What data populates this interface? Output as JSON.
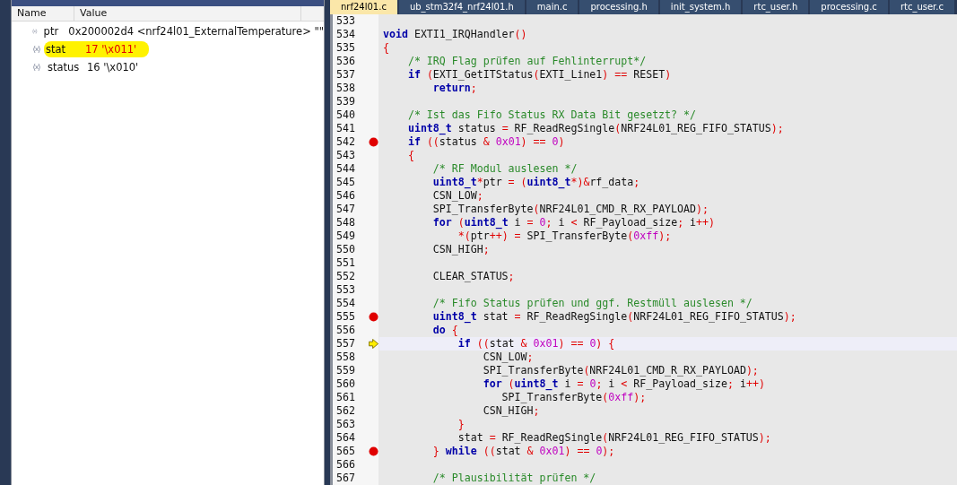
{
  "watches": {
    "columns": [
      "Name",
      "Value"
    ],
    "rows": [
      {
        "name": "ptr",
        "value": "0x200002d4 <nrf24l01_ExternalTemperature> \"\"",
        "changed": false,
        "highlighted": false
      },
      {
        "name": "stat",
        "value": "17 '\\x011'",
        "changed": true,
        "highlighted": true
      },
      {
        "name": "status",
        "value": "16 '\\x010'",
        "changed": false,
        "highlighted": false
      }
    ]
  },
  "tabs": [
    {
      "label": "nrf24l01.c",
      "selected": true
    },
    {
      "label": "ub_stm32f4_nrf24l01.h",
      "selected": false
    },
    {
      "label": "main.c",
      "selected": false
    },
    {
      "label": "processing.h",
      "selected": false
    },
    {
      "label": "init_system.h",
      "selected": false
    },
    {
      "label": "rtc_user.h",
      "selected": false
    },
    {
      "label": "processing.c",
      "selected": false
    },
    {
      "label": "rtc_user.c",
      "selected": false
    }
  ],
  "lines": [
    {
      "n": "533",
      "breakpoint": false,
      "current": false
    },
    {
      "n": "534",
      "breakpoint": false,
      "current": false,
      "code": [
        {
          "kind": "keyword",
          "text": "void"
        },
        {
          "kind": "plain",
          "text": " EXTI1_IRQHandler"
        },
        {
          "kind": "operator",
          "text": "()"
        }
      ]
    },
    {
      "n": "535",
      "breakpoint": false,
      "current": false,
      "code": [
        {
          "kind": "operator",
          "text": "{"
        }
      ]
    },
    {
      "n": "536",
      "breakpoint": false,
      "current": false,
      "code": [
        {
          "kind": "comment",
          "text": "    /* IRQ Flag prüfen auf Fehlinterrupt*/"
        }
      ]
    },
    {
      "n": "537",
      "breakpoint": false,
      "current": false,
      "code": [
        {
          "kind": "keyword",
          "text": "    if "
        },
        {
          "kind": "operator",
          "text": "("
        },
        {
          "kind": "plain",
          "text": "EXTI_GetITStatus"
        },
        {
          "kind": "operator",
          "text": "("
        },
        {
          "kind": "plain",
          "text": "EXTI_Line1"
        },
        {
          "kind": "operator",
          "text": ") =="
        },
        {
          "kind": "plain",
          "text": " RESET"
        },
        {
          "kind": "operator",
          "text": ")"
        }
      ]
    },
    {
      "n": "538",
      "breakpoint": false,
      "current": false,
      "code": [
        {
          "kind": "keyword",
          "text": "        return"
        },
        {
          "kind": "operator",
          "text": ";"
        }
      ]
    },
    {
      "n": "539",
      "breakpoint": false,
      "current": false
    },
    {
      "n": "540",
      "breakpoint": false,
      "current": false,
      "code": [
        {
          "kind": "comment",
          "text": "    /* Ist das Fifo Status RX Data Bit gesetzt? */"
        }
      ]
    },
    {
      "n": "541",
      "breakpoint": false,
      "current": false,
      "code": [
        {
          "kind": "keyword",
          "text": "    uint8_t"
        },
        {
          "kind": "plain",
          "text": " status "
        },
        {
          "kind": "operator",
          "text": "="
        },
        {
          "kind": "plain",
          "text": " RF_ReadRegSingle"
        },
        {
          "kind": "operator",
          "text": "("
        },
        {
          "kind": "plain",
          "text": "NRF24L01_REG_FIFO_STATUS"
        },
        {
          "kind": "operator",
          "text": ");"
        }
      ]
    },
    {
      "n": "542",
      "breakpoint": true,
      "current": false,
      "code": [
        {
          "kind": "keyword",
          "text": "    if "
        },
        {
          "kind": "operator",
          "text": "(("
        },
        {
          "kind": "plain",
          "text": "status "
        },
        {
          "kind": "operator",
          "text": "& "
        },
        {
          "kind": "number",
          "text": "0x01"
        },
        {
          "kind": "operator",
          "text": ") == "
        },
        {
          "kind": "number",
          "text": "0"
        },
        {
          "kind": "operator",
          "text": ")"
        }
      ]
    },
    {
      "n": "543",
      "breakpoint": false,
      "current": false,
      "code": [
        {
          "kind": "operator",
          "text": "    {"
        }
      ]
    },
    {
      "n": "544",
      "breakpoint": false,
      "current": false,
      "code": [
        {
          "kind": "comment",
          "text": "        /* RF Modul auslesen */"
        }
      ]
    },
    {
      "n": "545",
      "breakpoint": false,
      "current": false,
      "code": [
        {
          "kind": "keyword",
          "text": "        uint8_t"
        },
        {
          "kind": "operator",
          "text": "*"
        },
        {
          "kind": "plain",
          "text": "ptr "
        },
        {
          "kind": "operator",
          "text": "= ("
        },
        {
          "kind": "keyword",
          "text": "uint8_t"
        },
        {
          "kind": "operator",
          "text": "*)&"
        },
        {
          "kind": "plain",
          "text": "rf_data"
        },
        {
          "kind": "operator",
          "text": ";"
        }
      ]
    },
    {
      "n": "546",
      "breakpoint": false,
      "current": false,
      "code": [
        {
          "kind": "plain",
          "text": "        CSN_LOW"
        },
        {
          "kind": "operator",
          "text": ";"
        }
      ]
    },
    {
      "n": "547",
      "breakpoint": false,
      "current": false,
      "code": [
        {
          "kind": "plain",
          "text": "        SPI_TransferByte"
        },
        {
          "kind": "operator",
          "text": "("
        },
        {
          "kind": "plain",
          "text": "NRF24L01_CMD_R_RX_PAYLOAD"
        },
        {
          "kind": "operator",
          "text": ");"
        }
      ]
    },
    {
      "n": "548",
      "breakpoint": false,
      "current": false,
      "code": [
        {
          "kind": "keyword",
          "text": "        for "
        },
        {
          "kind": "operator",
          "text": "("
        },
        {
          "kind": "keyword",
          "text": "uint8_t"
        },
        {
          "kind": "plain",
          "text": " i "
        },
        {
          "kind": "operator",
          "text": "= "
        },
        {
          "kind": "number",
          "text": "0"
        },
        {
          "kind": "operator",
          "text": ";"
        },
        {
          "kind": "plain",
          "text": " i "
        },
        {
          "kind": "operator",
          "text": "<"
        },
        {
          "kind": "plain",
          "text": " RF_Payload_size"
        },
        {
          "kind": "operator",
          "text": ";"
        },
        {
          "kind": "plain",
          "text": " i"
        },
        {
          "kind": "operator",
          "text": "++)"
        }
      ]
    },
    {
      "n": "549",
      "breakpoint": false,
      "current": false,
      "code": [
        {
          "kind": "operator",
          "text": "            *("
        },
        {
          "kind": "plain",
          "text": "ptr"
        },
        {
          "kind": "operator",
          "text": "++) ="
        },
        {
          "kind": "plain",
          "text": " SPI_TransferByte"
        },
        {
          "kind": "operator",
          "text": "("
        },
        {
          "kind": "number",
          "text": "0xff"
        },
        {
          "kind": "operator",
          "text": ");"
        }
      ]
    },
    {
      "n": "550",
      "breakpoint": false,
      "current": false,
      "code": [
        {
          "kind": "plain",
          "text": "        CSN_HIGH"
        },
        {
          "kind": "operator",
          "text": ";"
        }
      ]
    },
    {
      "n": "551",
      "breakpoint": false,
      "current": false
    },
    {
      "n": "552",
      "breakpoint": false,
      "current": false,
      "code": [
        {
          "kind": "plain",
          "text": "        CLEAR_STATUS"
        },
        {
          "kind": "operator",
          "text": ";"
        }
      ]
    },
    {
      "n": "553",
      "breakpoint": false,
      "current": false
    },
    {
      "n": "554",
      "breakpoint": false,
      "current": false,
      "code": [
        {
          "kind": "comment",
          "text": "        /* Fifo Status prüfen und ggf. Restmüll auslesen */"
        }
      ]
    },
    {
      "n": "555",
      "breakpoint": true,
      "current": false,
      "code": [
        {
          "kind": "keyword",
          "text": "        uint8_t"
        },
        {
          "kind": "plain",
          "text": " stat "
        },
        {
          "kind": "operator",
          "text": "="
        },
        {
          "kind": "plain",
          "text": " RF_ReadRegSingle"
        },
        {
          "kind": "operator",
          "text": "("
        },
        {
          "kind": "plain",
          "text": "NRF24L01_REG_FIFO_STATUS"
        },
        {
          "kind": "operator",
          "text": ");"
        }
      ]
    },
    {
      "n": "556",
      "breakpoint": false,
      "current": false,
      "code": [
        {
          "kind": "keyword",
          "text": "        do "
        },
        {
          "kind": "operator",
          "text": "{"
        }
      ]
    },
    {
      "n": "557",
      "breakpoint": false,
      "current": true,
      "code": [
        {
          "kind": "keyword",
          "text": "            if "
        },
        {
          "kind": "operator",
          "text": "(("
        },
        {
          "kind": "plain",
          "text": "stat "
        },
        {
          "kind": "operator",
          "text": "& "
        },
        {
          "kind": "number",
          "text": "0x01"
        },
        {
          "kind": "operator",
          "text": ") == "
        },
        {
          "kind": "number",
          "text": "0"
        },
        {
          "kind": "operator",
          "text": ") {"
        }
      ]
    },
    {
      "n": "558",
      "breakpoint": false,
      "current": false,
      "code": [
        {
          "kind": "plain",
          "text": "                CSN_LOW"
        },
        {
          "kind": "operator",
          "text": ";"
        }
      ]
    },
    {
      "n": "559",
      "breakpoint": false,
      "current": false,
      "code": [
        {
          "kind": "plain",
          "text": "                SPI_TransferByte"
        },
        {
          "kind": "operator",
          "text": "("
        },
        {
          "kind": "plain",
          "text": "NRF24L01_CMD_R_RX_PAYLOAD"
        },
        {
          "kind": "operator",
          "text": ");"
        }
      ]
    },
    {
      "n": "560",
      "breakpoint": false,
      "current": false,
      "code": [
        {
          "kind": "keyword",
          "text": "                for "
        },
        {
          "kind": "operator",
          "text": "("
        },
        {
          "kind": "keyword",
          "text": "uint8_t"
        },
        {
          "kind": "plain",
          "text": " i "
        },
        {
          "kind": "operator",
          "text": "= "
        },
        {
          "kind": "number",
          "text": "0"
        },
        {
          "kind": "operator",
          "text": ";"
        },
        {
          "kind": "plain",
          "text": " i "
        },
        {
          "kind": "operator",
          "text": "<"
        },
        {
          "kind": "plain",
          "text": " RF_Payload_size"
        },
        {
          "kind": "operator",
          "text": ";"
        },
        {
          "kind": "plain",
          "text": " i"
        },
        {
          "kind": "operator",
          "text": "++)"
        }
      ]
    },
    {
      "n": "561",
      "breakpoint": false,
      "current": false,
      "code": [
        {
          "kind": "plain",
          "text": "                   SPI_TransferByte"
        },
        {
          "kind": "operator",
          "text": "("
        },
        {
          "kind": "number",
          "text": "0xff"
        },
        {
          "kind": "operator",
          "text": ");"
        }
      ]
    },
    {
      "n": "562",
      "breakpoint": false,
      "current": false,
      "code": [
        {
          "kind": "plain",
          "text": "                CSN_HIGH"
        },
        {
          "kind": "operator",
          "text": ";"
        }
      ]
    },
    {
      "n": "563",
      "breakpoint": false,
      "current": false,
      "code": [
        {
          "kind": "operator",
          "text": "            }"
        }
      ]
    },
    {
      "n": "564",
      "breakpoint": false,
      "current": false,
      "code": [
        {
          "kind": "plain",
          "text": "            stat "
        },
        {
          "kind": "operator",
          "text": "="
        },
        {
          "kind": "plain",
          "text": " RF_ReadRegSingle"
        },
        {
          "kind": "operator",
          "text": "("
        },
        {
          "kind": "plain",
          "text": "NRF24L01_REG_FIFO_STATUS"
        },
        {
          "kind": "operator",
          "text": ");"
        }
      ]
    },
    {
      "n": "565",
      "breakpoint": true,
      "current": false,
      "code": [
        {
          "kind": "operator",
          "text": "        } "
        },
        {
          "kind": "keyword",
          "text": "while "
        },
        {
          "kind": "operator",
          "text": "(("
        },
        {
          "kind": "plain",
          "text": "stat "
        },
        {
          "kind": "operator",
          "text": "& "
        },
        {
          "kind": "number",
          "text": "0x01"
        },
        {
          "kind": "operator",
          "text": ") == "
        },
        {
          "kind": "number",
          "text": "0"
        },
        {
          "kind": "operator",
          "text": ");"
        }
      ]
    },
    {
      "n": "566",
      "breakpoint": false,
      "current": false
    },
    {
      "n": "567",
      "breakpoint": false,
      "current": false,
      "code": [
        {
          "kind": "comment",
          "text": "        /* Plausibilität prüfen */"
        }
      ]
    }
  ]
}
